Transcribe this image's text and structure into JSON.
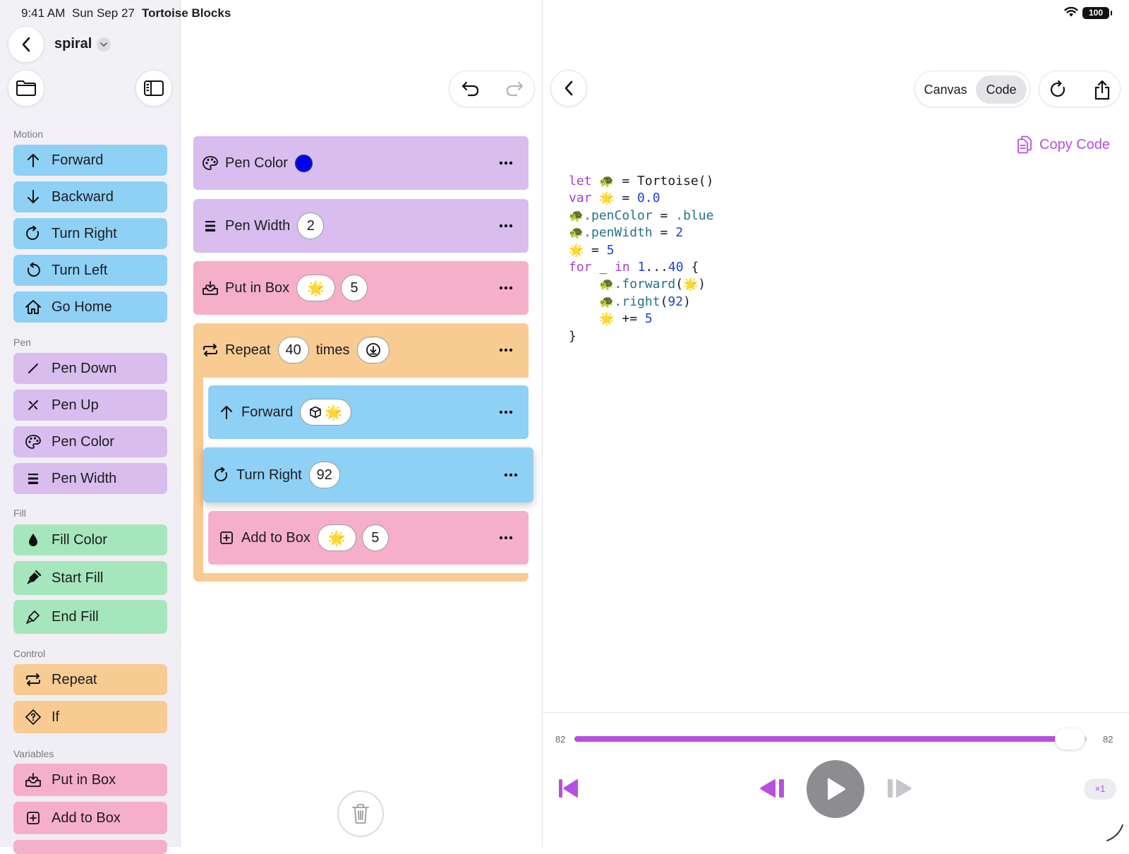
{
  "status_bar": {
    "time": "9:41 AM",
    "date": "Sun Sep 27",
    "app": "Tortoise Blocks",
    "battery": "100"
  },
  "sidebar": {
    "project_name": "spiral",
    "categories": [
      {
        "label": "Motion",
        "items": [
          "Forward",
          "Backward",
          "Turn Right",
          "Turn Left",
          "Go Home"
        ]
      },
      {
        "label": "Pen",
        "items": [
          "Pen Down",
          "Pen Up",
          "Pen Color",
          "Pen Width"
        ]
      },
      {
        "label": "Fill",
        "items": [
          "Fill Color",
          "Start Fill",
          "End Fill"
        ]
      },
      {
        "label": "Control",
        "items": [
          "Repeat",
          "If"
        ]
      },
      {
        "label": "Variables",
        "items": [
          "Put in Box",
          "Add to Box"
        ]
      }
    ]
  },
  "editor": {
    "blocks": {
      "pen_color": {
        "label": "Pen Color",
        "color": "#0000ee"
      },
      "pen_width": {
        "label": "Pen Width",
        "value": "2"
      },
      "put_in_box": {
        "label": "Put in Box",
        "var": "🌟",
        "value": "5"
      },
      "repeat": {
        "label": "Repeat",
        "count": "40",
        "suffix": "times"
      },
      "forward": {
        "label": "Forward",
        "var": "🌟"
      },
      "turn_right": {
        "label": "Turn Right",
        "value": "92"
      },
      "add_to_box": {
        "label": "Add to Box",
        "var": "🌟",
        "value": "5"
      }
    }
  },
  "right": {
    "segments": [
      "Canvas",
      "Code"
    ],
    "selected_segment": "Code",
    "copy_label": "Copy Code",
    "code_lines": [
      [
        [
          "kw",
          "let"
        ],
        [
          "p",
          " "
        ],
        [
          "emo",
          "🐢"
        ],
        [
          "p",
          " = Tortoise()"
        ]
      ],
      [
        [
          "kw",
          "var"
        ],
        [
          "p",
          " "
        ],
        [
          "emo",
          "🌟"
        ],
        [
          "p",
          " = "
        ],
        [
          "num",
          "0.0"
        ]
      ],
      [
        [
          "emo",
          "🐢"
        ],
        [
          "prop",
          ".penColor"
        ],
        [
          "p",
          " = "
        ],
        [
          "prop",
          ".blue"
        ]
      ],
      [
        [
          "emo",
          "🐢"
        ],
        [
          "prop",
          ".penWidth"
        ],
        [
          "p",
          " = "
        ],
        [
          "num",
          "2"
        ]
      ],
      [
        [
          "emo",
          "🌟"
        ],
        [
          "p",
          " = "
        ],
        [
          "num",
          "5"
        ]
      ],
      [
        [
          "kw",
          "for"
        ],
        [
          "p",
          " _ "
        ],
        [
          "kw",
          "in"
        ],
        [
          "p",
          " "
        ],
        [
          "num",
          "1"
        ],
        [
          "p",
          "..."
        ],
        [
          "num",
          "40"
        ],
        [
          "p",
          " {"
        ]
      ],
      [
        [
          "p",
          "    "
        ],
        [
          "emo",
          "🐢"
        ],
        [
          "prop",
          ".forward"
        ],
        [
          "p",
          "("
        ],
        [
          "emo",
          "🌟"
        ],
        [
          "p",
          ")"
        ]
      ],
      [
        [
          "p",
          "    "
        ],
        [
          "emo",
          "🐢"
        ],
        [
          "prop",
          ".right"
        ],
        [
          "p",
          "("
        ],
        [
          "num",
          "92"
        ],
        [
          "p",
          ")"
        ]
      ],
      [
        [
          "p",
          "    "
        ],
        [
          "emo",
          "🌟"
        ],
        [
          "p",
          " += "
        ],
        [
          "num",
          "5"
        ]
      ],
      [
        [
          "p",
          "}"
        ]
      ]
    ],
    "scrubber": {
      "start": "82",
      "end": "82",
      "progress": 0.965
    },
    "speed": "×1",
    "accent": "#b84fe0"
  }
}
